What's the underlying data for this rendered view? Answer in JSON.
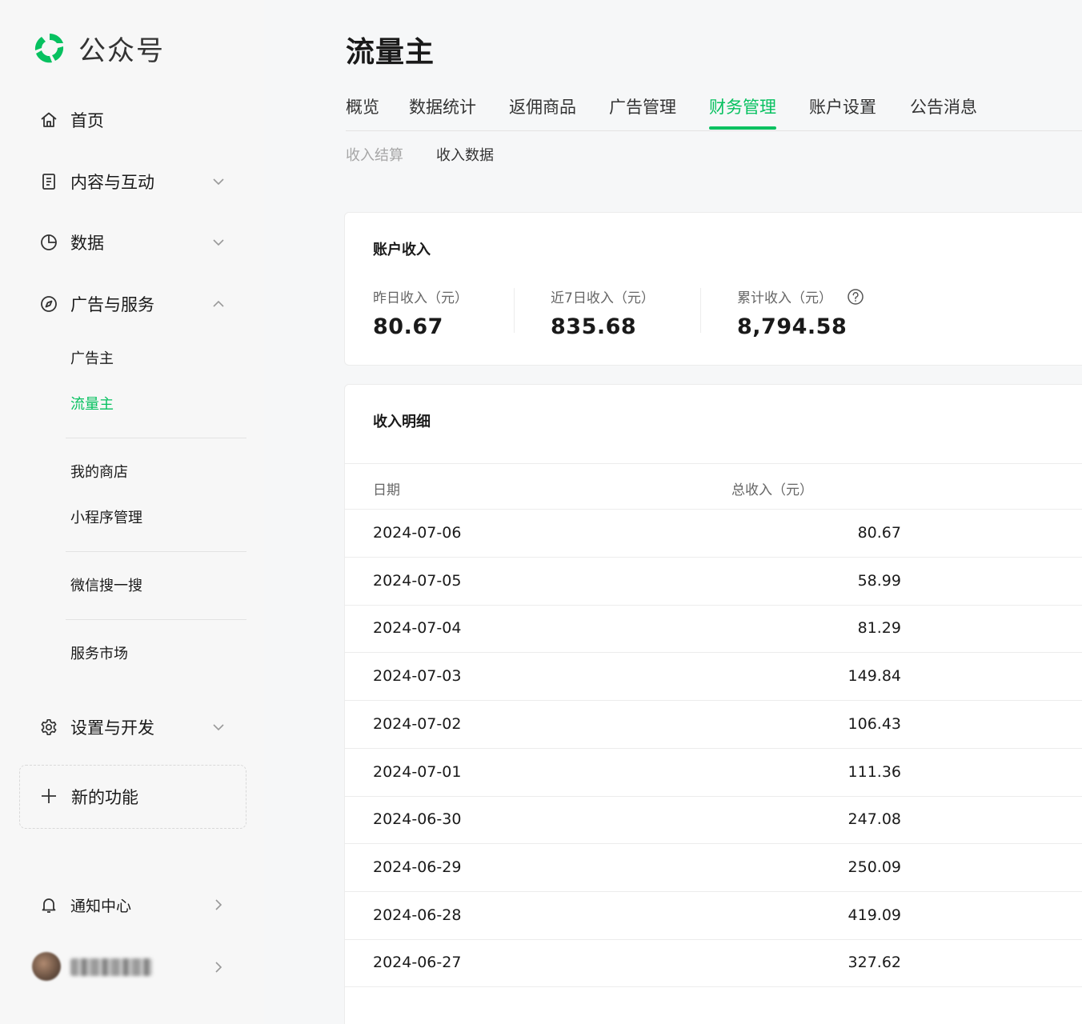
{
  "app": {
    "name": "公众号"
  },
  "sidebar": {
    "items": [
      {
        "label": "首页",
        "icon": "home-icon"
      },
      {
        "label": "内容与互动",
        "icon": "document-icon",
        "expanded": false
      },
      {
        "label": "数据",
        "icon": "pie-chart-icon",
        "expanded": false
      },
      {
        "label": "广告与服务",
        "icon": "compass-icon",
        "expanded": true
      }
    ],
    "ads_sub": [
      {
        "label": "广告主",
        "active": false
      },
      {
        "label": "流量主",
        "active": true
      },
      {
        "label": "我的商店",
        "active": false
      },
      {
        "label": "小程序管理",
        "active": false
      },
      {
        "label": "微信搜一搜",
        "active": false
      },
      {
        "label": "服务市场",
        "active": false
      }
    ],
    "settings": {
      "label": "设置与开发",
      "icon": "gear-icon"
    },
    "new_feature": {
      "label": "新的功能",
      "icon": "plus-icon"
    },
    "notifications": {
      "label": "通知中心",
      "icon": "bell-icon"
    }
  },
  "main": {
    "title": "流量主",
    "tabs": [
      {
        "label": "概览",
        "active": false
      },
      {
        "label": "数据统计",
        "active": false
      },
      {
        "label": "返佣商品",
        "active": false
      },
      {
        "label": "广告管理",
        "active": false
      },
      {
        "label": "财务管理",
        "active": true
      },
      {
        "label": "账户设置",
        "active": false
      },
      {
        "label": "公告消息",
        "active": false
      }
    ],
    "subtabs": [
      {
        "label": "收入结算",
        "active": false
      },
      {
        "label": "收入数据",
        "active": true
      }
    ],
    "account_income": {
      "title": "账户收入",
      "stats": [
        {
          "label": "昨日收入（元）",
          "value": "80.67"
        },
        {
          "label": "近7日收入（元）",
          "value": "835.68"
        },
        {
          "label": "累计收入（元）",
          "value": "8,794.58",
          "help_icon": "question-circle-icon"
        }
      ]
    },
    "income_detail": {
      "title": "收入明细",
      "columns": [
        "日期",
        "总收入（元）"
      ],
      "rows": [
        {
          "date": "2024-07-06",
          "value": "80.67"
        },
        {
          "date": "2024-07-05",
          "value": "58.99"
        },
        {
          "date": "2024-07-04",
          "value": "81.29"
        },
        {
          "date": "2024-07-03",
          "value": "149.84"
        },
        {
          "date": "2024-07-02",
          "value": "106.43"
        },
        {
          "date": "2024-07-01",
          "value": "111.36"
        },
        {
          "date": "2024-06-30",
          "value": "247.08"
        },
        {
          "date": "2024-06-29",
          "value": "250.09"
        },
        {
          "date": "2024-06-28",
          "value": "419.09"
        },
        {
          "date": "2024-06-27",
          "value": "327.62"
        }
      ]
    }
  },
  "colors": {
    "accent": "#07c160",
    "text": "#1a1a1a",
    "muted": "#a6a6a6"
  }
}
